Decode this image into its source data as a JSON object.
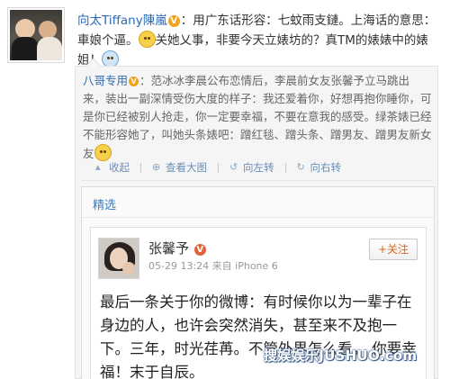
{
  "post": {
    "author": "向太Tiffany陳嵐",
    "badge": "V",
    "text_1": "：用广东话形容：七蚊雨支鏈。上海话的意思：車娘个逼。",
    "text_2": "关她乂事，非要今天立婊坊的？真TM的婊婊中的婊姐！",
    "emoji_1": "smirk-emoji",
    "emoji_2": "cry-emoji"
  },
  "repost": {
    "author": "八哥专用",
    "badge": "V",
    "text": "：范冰冰李晨公布恋情后，李晨前女友张馨予立马跳出来，装出一副深情受伤大度的样子：我还爱着你，好想再抱你睡你，可是你已经被别人抢走，你一定要幸福，不要在意我的感受。绿茶婊已经不能形容她了，叫她头条婊吧：蹭红毯、蹭头条、蹭男友、蹭男友新女友",
    "emoji": "smile-emoji",
    "actions": {
      "collapse": "收起",
      "view_large": "查看大图",
      "rotate_left": "向左转",
      "rotate_right": "向右转"
    }
  },
  "featured": {
    "header": "精选",
    "card": {
      "name": "张馨予",
      "meta": "05-29 13:24  来自 iPhone 6",
      "follow": "+关注",
      "text": "最后一条关于你的微博：有时候你以为一辈子在身边的人，也许会突然消失，甚至来不及抱一下。三年，时光荏苒。不管外界怎么看。 你要幸福！末于自辰。"
    }
  },
  "watermark": "搜娱娱乐JUSHUO.com",
  "colors": {
    "link": "#2b6ab3",
    "badge": "#f2a31a",
    "follow_text": "#e3631f",
    "repost_bg": "#f5f5f5"
  }
}
